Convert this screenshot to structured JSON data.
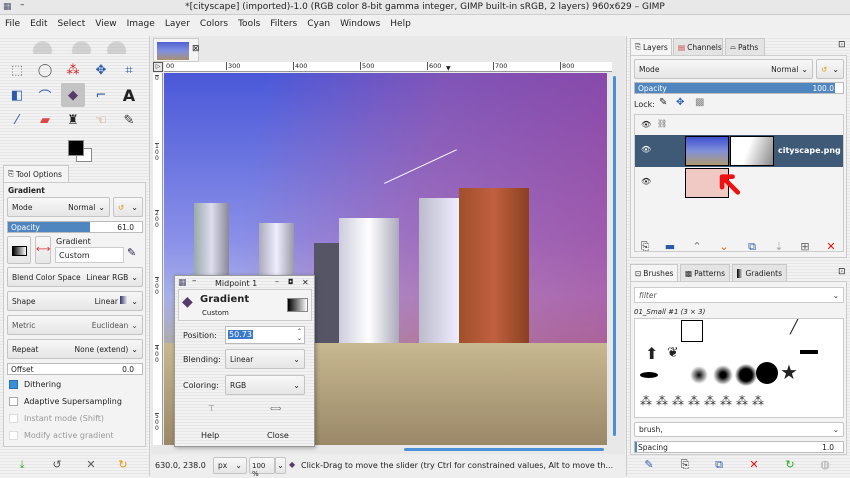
{
  "window": {
    "title": "*[cityscape] (imported)-1.0 (RGB color 8-bit gamma integer, GIMP built-in sRGB, 2 layers) 960x629 – GIMP"
  },
  "menu": [
    "File",
    "Edit",
    "Select",
    "View",
    "Image",
    "Layer",
    "Colors",
    "Tools",
    "Filters",
    "Cyan",
    "Windows",
    "Help"
  ],
  "tool_options": {
    "tab": "Tool Options",
    "tool": "Gradient",
    "mode_label": "Mode",
    "mode_value": "Normal",
    "opacity_label": "Opacity",
    "opacity_value": "61.0",
    "opacity_fraction": 0.61,
    "gradient_label": "Gradient",
    "gradient_value": "Custom",
    "blend_label": "Blend Color Space",
    "blend_value": "Linear RGB",
    "shape_label": "Shape",
    "shape_value": "Linear",
    "metric_label": "Metric",
    "metric_value": "Euclidean",
    "repeat_label": "Repeat",
    "repeat_value": "None (extend)",
    "offset_label": "Offset",
    "offset_value": "0.0",
    "dithering": "Dithering",
    "adaptive": "Adaptive Supersampling",
    "instant": "Instant mode  (Shift)",
    "modify": "Modify active gradient"
  },
  "ruler": {
    "h": [
      "00",
      "300",
      "400",
      "500",
      "600",
      "700",
      "800"
    ],
    "v": [
      "0",
      "1\n0\n0",
      "2\n0\n0",
      "3\n0\n0",
      "4\n0\n0",
      "5\n0\n0"
    ]
  },
  "dialog": {
    "title": "Midpoint 1",
    "heading": "Gradient",
    "sub": "Custom",
    "position_label": "Position:",
    "position_value": "50.73",
    "blending_label": "Blending:",
    "blending_value": "Linear",
    "coloring_label": "Coloring:",
    "coloring_value": "RGB",
    "help": "Help",
    "close": "Close"
  },
  "status": {
    "coords": "630.0, 238.0",
    "unit": "px",
    "zoom": "100 %",
    "message": "Click-Drag to move the slider (try Ctrl for constrained values, Alt to move th..."
  },
  "layers": {
    "tabs": [
      "Layers",
      "Channels",
      "Paths"
    ],
    "mode_label": "Mode",
    "mode_value": "Normal",
    "opacity_label": "Opacity",
    "opacity_value": "100.0",
    "opacity_fraction": 1.0,
    "lock_label": "Lock:",
    "items": [
      {
        "name": "cityscape.png"
      },
      {
        "name": ""
      }
    ]
  },
  "brushes": {
    "tabs": [
      "Brushes",
      "Patterns",
      "Gradients"
    ],
    "filter_placeholder": "filter",
    "selected": "01_Small #1 (3 × 3)",
    "tag_value": "brush,",
    "spacing_label": "Spacing",
    "spacing_value": "1.0"
  }
}
